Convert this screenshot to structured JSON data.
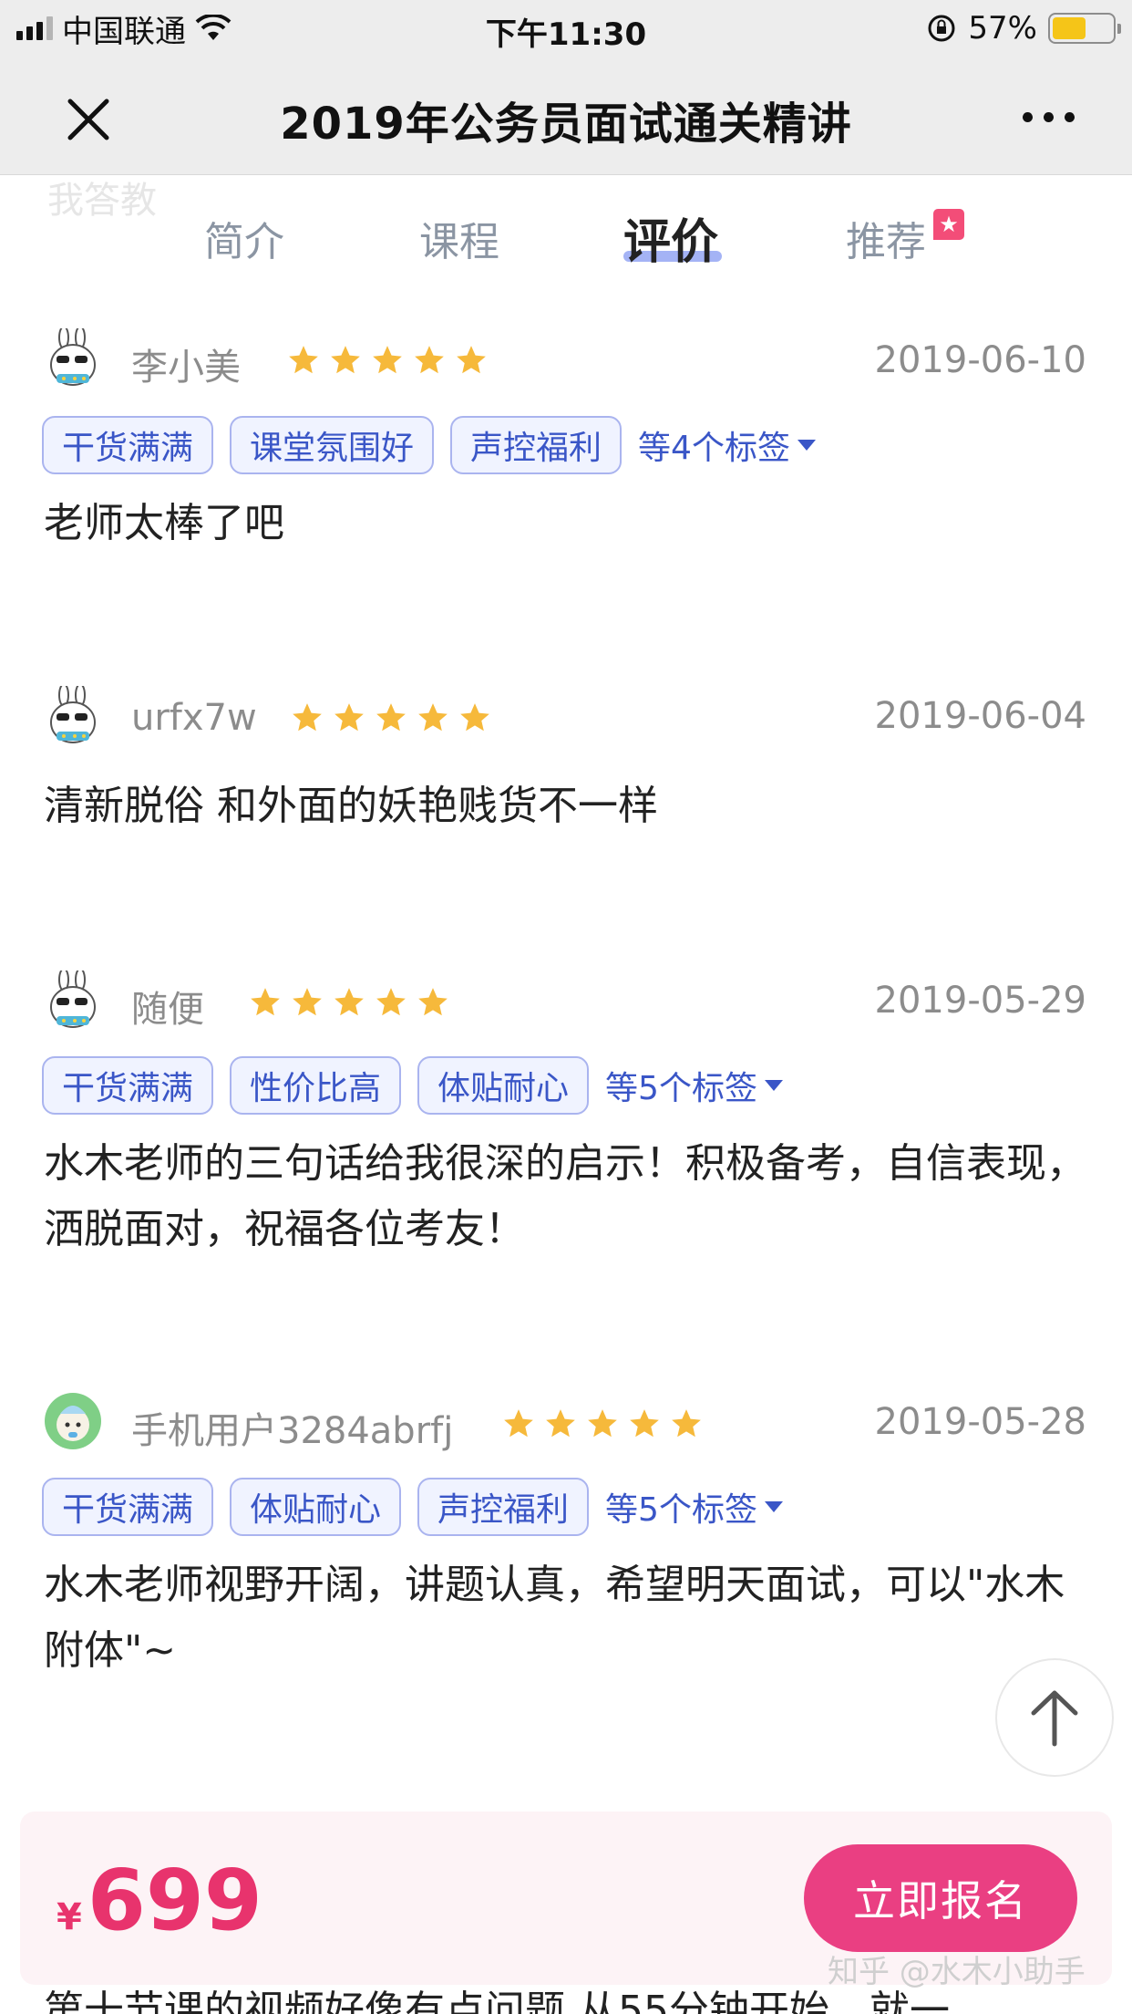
{
  "status_bar": {
    "carrier": "中国联通",
    "time": "下午11:30",
    "battery": "57%",
    "battery_level": 0.57
  },
  "nav": {
    "title": "2019年公务员面试通关精讲"
  },
  "tabs": {
    "ghost": "我答教",
    "items": [
      {
        "label": "简介"
      },
      {
        "label": "课程"
      },
      {
        "label": "评价"
      },
      {
        "label": "推荐"
      }
    ],
    "active": "评价",
    "recommend_badge_icon": "star-icon"
  },
  "reviews": [
    {
      "avatar": "rabbit-sunglasses-avatar",
      "username": "李小美",
      "stars": 5,
      "date": "2019-06-10",
      "tags": [
        "干货满满",
        "课堂氛围好",
        "声控福利"
      ],
      "more_tags": "等4个标签",
      "text": "老师太棒了吧"
    },
    {
      "avatar": "rabbit-sunglasses-avatar",
      "username": "urfx7w",
      "stars": 5,
      "date": "2019-06-04",
      "tags": [],
      "more_tags": "",
      "text": "清新脱俗 和外面的妖艳贱货不一样"
    },
    {
      "avatar": "rabbit-sunglasses-avatar",
      "username": "随便",
      "stars": 5,
      "date": "2019-05-29",
      "tags": [
        "干货满满",
        "性价比高",
        "体贴耐心"
      ],
      "more_tags": "等5个标签",
      "text": "水木老师的三句话给我很深的启示！积极备考，自信表现，洒脱面对，祝福各位考友！"
    },
    {
      "avatar": "green-cartoon-avatar",
      "username": "手机用户3284abrfj",
      "stars": 5,
      "date": "2019-05-28",
      "tags": [
        "干货满满",
        "体贴耐心",
        "声控福利"
      ],
      "more_tags": "等5个标签",
      "text": "水木老师视野开阔，讲题认真，希望明天面试，可以\"水木附体\"~"
    }
  ],
  "bottom": {
    "currency": "¥",
    "price": "699",
    "enroll_label": "立即报名",
    "next_review_partial": "第十节课的视频好像有点问题 从55分钟开始，就一",
    "watermark": "知乎 @水木小助手"
  },
  "colors": {
    "accent": "#e8336d",
    "tag_text": "#3a56c7",
    "star": "#f6b93b"
  }
}
